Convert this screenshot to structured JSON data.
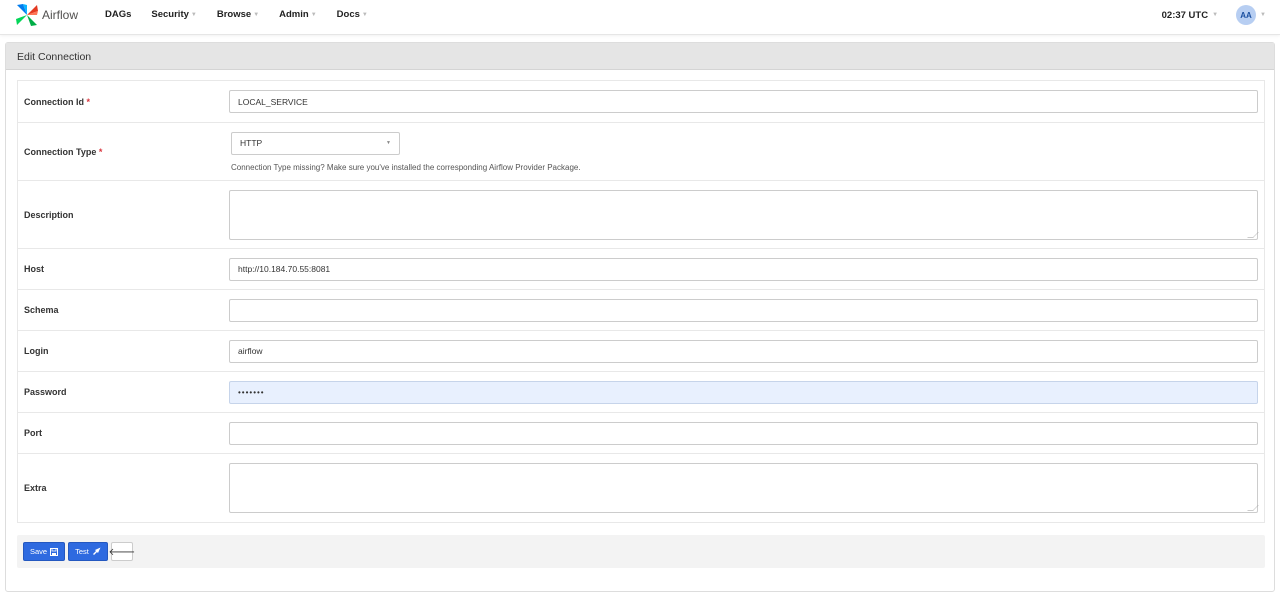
{
  "navbar": {
    "brand": "Airflow",
    "items": [
      {
        "label": "DAGs",
        "has_caret": false
      },
      {
        "label": "Security",
        "has_caret": true
      },
      {
        "label": "Browse",
        "has_caret": true
      },
      {
        "label": "Admin",
        "has_caret": true
      },
      {
        "label": "Docs",
        "has_caret": true
      }
    ],
    "clock": "02:37 UTC",
    "user_initials": "AA"
  },
  "panel": {
    "title": "Edit Connection"
  },
  "form": {
    "connection_id": {
      "label": "Connection Id",
      "value": "LOCAL_SERVICE",
      "required_mark": "*"
    },
    "connection_type": {
      "label": "Connection Type",
      "value": "HTTP",
      "required_mark": "*",
      "help": "Connection Type missing? Make sure you've installed the corresponding Airflow Provider Package."
    },
    "description": {
      "label": "Description",
      "value": ""
    },
    "host": {
      "label": "Host",
      "value": "http://10.184.70.55:8081"
    },
    "schema": {
      "label": "Schema",
      "value": ""
    },
    "login": {
      "label": "Login",
      "value": "airflow"
    },
    "password": {
      "label": "Password",
      "value": "•••••••"
    },
    "port": {
      "label": "Port",
      "value": ""
    },
    "extra": {
      "label": "Extra",
      "value": ""
    }
  },
  "actions": {
    "save_label": "Save",
    "test_label": "Test",
    "back_glyph": "🡐"
  },
  "colors": {
    "primary_button": "#2e6ae0",
    "required": "#d9363e",
    "autofill_bg": "#e8f0fe"
  }
}
